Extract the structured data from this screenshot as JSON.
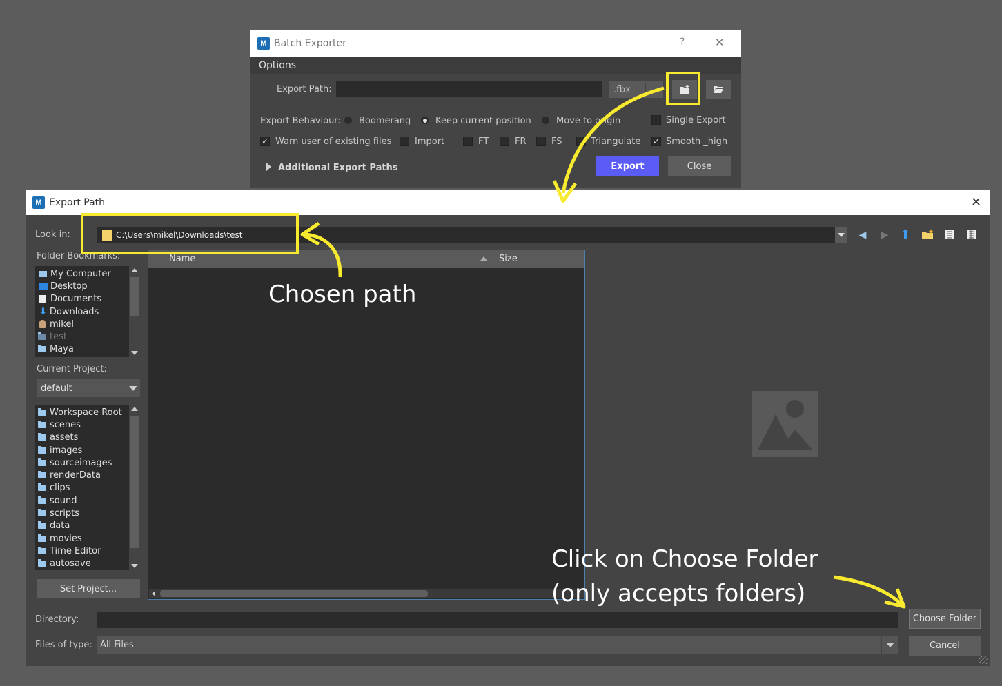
{
  "batch": {
    "title": "Batch Exporter",
    "help": "?",
    "close_x": "✕",
    "menu": "Options",
    "export_path_label": "Export Path:",
    "export_path_value": "",
    "format": ".fbx",
    "behaviour_label": "Export Behaviour:",
    "radio_boomerang": "Boomerang",
    "radio_keep": "Keep current position",
    "radio_move": "Move to origin",
    "single_export": "Single Export",
    "warn": "Warn user of existing files",
    "import": "Import",
    "ft": "FT",
    "fr": "FR",
    "fs": "FS",
    "triangulate": "Triangulate",
    "smooth": "Smooth _high",
    "additional": "Additional Export Paths",
    "export_btn": "Export",
    "close_btn": "Close"
  },
  "dialog": {
    "title": "Export Path",
    "close_x": "✕",
    "look_in_label": "Look in:",
    "look_in_value": "C:\\Users\\mikel\\Downloads\\test",
    "bookmarks_label": "Folder Bookmarks:",
    "bookmarks": [
      "My Computer",
      "Desktop",
      "Documents",
      "Downloads",
      "mikel",
      "test",
      "Maya"
    ],
    "current_project_label": "Current Project:",
    "current_project_value": "default",
    "project_folders": [
      "Workspace Root",
      "scenes",
      "assets",
      "images",
      "sourceimages",
      "renderData",
      "clips",
      "sound",
      "scripts",
      "data",
      "movies",
      "Time Editor",
      "autosave"
    ],
    "set_project": "Set Project...",
    "col_name": "Name",
    "col_size": "Size",
    "directory_label": "Directory:",
    "directory_value": "",
    "files_type_label": "Files of type:",
    "files_type_value": "All Files",
    "choose_folder": "Choose Folder",
    "cancel": "Cancel"
  },
  "annotations": {
    "chosen_path": "Chosen path",
    "click_line1": "Click on Choose Folder",
    "click_line2": "(only accepts folders)"
  },
  "colors": {
    "highlight": "#f8ea2e",
    "export_button": "#5a5cf5",
    "background": "#5c5c5c"
  }
}
